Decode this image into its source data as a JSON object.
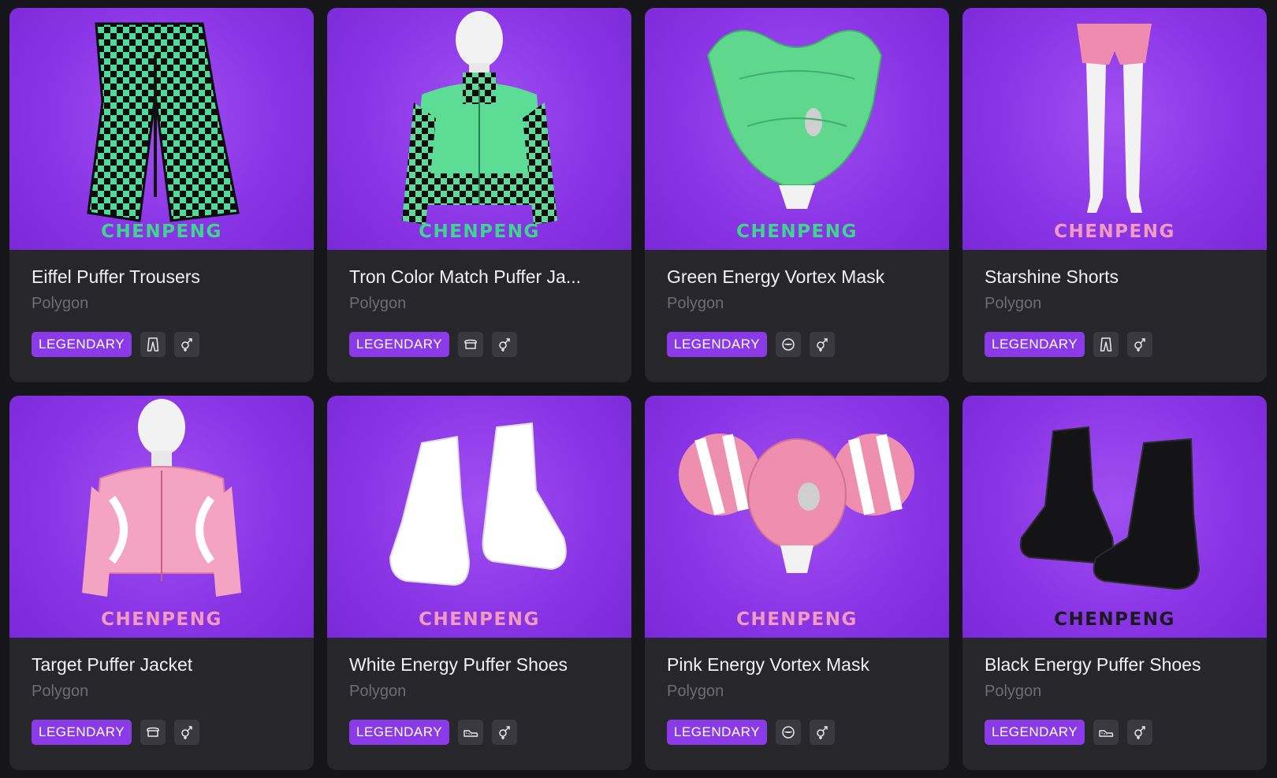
{
  "items": [
    {
      "name": "Eiffel Puffer Trousers",
      "creator": "Polygon",
      "rarity": "LEGENDARY",
      "category_icon": "trousers-icon",
      "gender_icon": "unisex-icon",
      "watermark": "CHENPENG",
      "watermark_color": "#3ed68c",
      "art": "trousers-checker",
      "art_color": "#4fdc94"
    },
    {
      "name": "Tron Color Match Puffer Ja...",
      "creator": "Polygon",
      "rarity": "LEGENDARY",
      "category_icon": "top-icon",
      "gender_icon": "unisex-icon",
      "watermark": "CHENPENG",
      "watermark_color": "#3ed68c",
      "art": "jacket",
      "art_color": "#5ddc95"
    },
    {
      "name": "Green Energy Vortex Mask",
      "creator": "Polygon",
      "rarity": "LEGENDARY",
      "category_icon": "mask-icon",
      "gender_icon": "unisex-icon",
      "watermark": "CHENPENG",
      "watermark_color": "#3ed68c",
      "art": "mask-green",
      "art_color": "#5fd88e"
    },
    {
      "name": "Starshine Shorts",
      "creator": "Polygon",
      "rarity": "LEGENDARY",
      "category_icon": "trousers-icon",
      "gender_icon": "unisex-icon",
      "watermark": "CHENPENG",
      "watermark_color": "#f29bc0",
      "art": "shorts",
      "art_color": "#f08bb0"
    },
    {
      "name": "Target Puffer Jacket",
      "creator": "Polygon",
      "rarity": "LEGENDARY",
      "category_icon": "top-icon",
      "gender_icon": "unisex-icon",
      "watermark": "CHENPENG",
      "watermark_color": "#f29bc0",
      "art": "jacket-pink",
      "art_color": "#f4a3c3"
    },
    {
      "name": "White Energy Puffer Shoes",
      "creator": "Polygon",
      "rarity": "LEGENDARY",
      "category_icon": "shoe-icon",
      "gender_icon": "unisex-icon",
      "watermark": "CHENPENG",
      "watermark_color": "#f29bc0",
      "art": "boots-white",
      "art_color": "#ffffff"
    },
    {
      "name": "Pink Energy Vortex Mask",
      "creator": "Polygon",
      "rarity": "LEGENDARY",
      "category_icon": "mask-icon",
      "gender_icon": "unisex-icon",
      "watermark": "CHENPENG",
      "watermark_color": "#f29bc0",
      "art": "mask-pink",
      "art_color": "#ee8fb0"
    },
    {
      "name": "Black Energy Puffer Shoes",
      "creator": "Polygon",
      "rarity": "LEGENDARY",
      "category_icon": "shoe-icon",
      "gender_icon": "unisex-icon",
      "watermark": "CHENPENG",
      "watermark_color": "#1a1a1e",
      "art": "boots-black",
      "art_color": "#141416"
    }
  ]
}
